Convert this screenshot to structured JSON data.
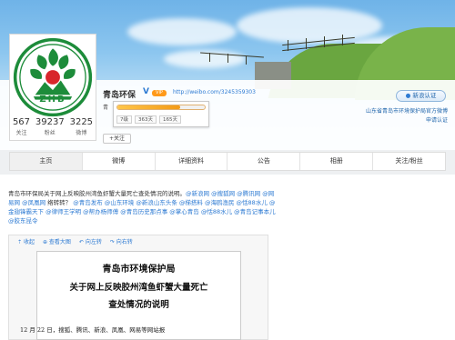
{
  "profile": {
    "name": "青岛环保",
    "verified_mark": "V",
    "vip_badge": "VIP",
    "url": "http://weibo.com/3245359303",
    "intro_prefix": "青",
    "logo_text": "ZHB",
    "follow_label": "+关注",
    "level_progress": 0.72,
    "tooltip_items": [
      "7级",
      "363天",
      "165天"
    ],
    "stats": [
      {
        "num": "567",
        "label": "关注"
      },
      {
        "num": "39237",
        "label": "粉丝"
      },
      {
        "num": "3225",
        "label": "微博"
      }
    ]
  },
  "verification": {
    "button_label": "新浪认证",
    "text": "山东省青岛市环境保护局官方微博",
    "apply_label": "申请认证"
  },
  "nav": {
    "tabs": [
      "主页",
      "微博",
      "详细资料",
      "公告",
      "相册",
      "关注/粉丝"
    ],
    "active_index": 0
  },
  "post": {
    "lead": "青岛市环保局关于网上反映胶州湾鱼虾蟹大量死亡查处情况的说明。",
    "mentions_1": "@新浪网 @搜狐网 @腾讯网 @网易网 @凤凰网",
    "middle": " 络转转？ ",
    "mentions_2": "@青岛发布 @山东环境 @新浪山东头条 @梯搭料 @海鸥渔民 @恬88水儿 @金翅锋霸天下 @律师王学明 @帮办杨师傅 @青岛历史那点事 @掌心青岛 @恬88水儿 @青岛记事本儿 @胶东昆令"
  },
  "doc": {
    "toolbar": [
      "收起",
      "查看大图",
      "向左转",
      "向右转"
    ],
    "title_1": "青岛市环境保护局",
    "title_2": "关于网上反映胶州湾鱼虾蟹大量死亡",
    "title_3": "查处情况的说明",
    "body_line": "12 月 22 日，搜狐、腾讯、新浪、凤凰、网易等网站报"
  },
  "colors": {
    "link": "#2e7bd3",
    "vip": "#ff9a1a",
    "logo_green": "#1d8c3a",
    "logo_red": "#d8262c"
  }
}
